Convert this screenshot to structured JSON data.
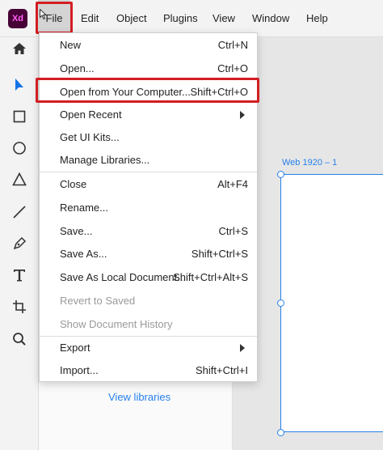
{
  "app": {
    "logo_text": "Xd",
    "logo_bg": "#470137",
    "logo_fg": "#ff61f6"
  },
  "menubar": {
    "items": [
      {
        "label": "File"
      },
      {
        "label": "Edit"
      },
      {
        "label": "Object"
      },
      {
        "label": "Plugins"
      },
      {
        "label": "View"
      },
      {
        "label": "Window"
      },
      {
        "label": "Help"
      }
    ]
  },
  "toolbar": {
    "tools": [
      "home-icon",
      "select-arrow-icon",
      "rectangle-icon",
      "ellipse-icon",
      "triangle-icon",
      "line-icon",
      "pen-icon",
      "text-icon",
      "artboard-icon",
      "zoom-icon"
    ]
  },
  "file_menu": {
    "items": [
      {
        "label": "New",
        "shortcut": "Ctrl+N"
      },
      {
        "label": "Open...",
        "shortcut": "Ctrl+O"
      },
      {
        "label": "Open from Your Computer...",
        "shortcut": "Shift+Ctrl+O",
        "highlighted": true
      },
      {
        "label": "Open Recent",
        "shortcut": "",
        "submenu": true
      },
      {
        "label": "Get UI Kits...",
        "shortcut": ""
      },
      {
        "label": "Manage Libraries...",
        "shortcut": ""
      },
      {
        "label": "Close",
        "shortcut": "Alt+F4"
      },
      {
        "label": "Rename...",
        "shortcut": ""
      },
      {
        "label": "Save...",
        "shortcut": "Ctrl+S"
      },
      {
        "label": "Save As...",
        "shortcut": "Shift+Ctrl+S"
      },
      {
        "label": "Save As Local Document...",
        "shortcut": "Shift+Ctrl+Alt+S"
      },
      {
        "label": "Revert to Saved",
        "shortcut": "",
        "disabled": true
      },
      {
        "label": "Show Document History",
        "shortcut": "",
        "disabled": true
      },
      {
        "label": "Export",
        "shortcut": "",
        "submenu": true
      },
      {
        "label": "Import...",
        "shortcut": "Shift+Ctrl+I"
      }
    ]
  },
  "library_panel": {
    "view_libraries_link": "View libraries"
  },
  "canvas": {
    "artboard_label": "Web 1920 – 1"
  },
  "colors": {
    "accent": "#2680eb",
    "highlight_box": "#d21e23"
  }
}
